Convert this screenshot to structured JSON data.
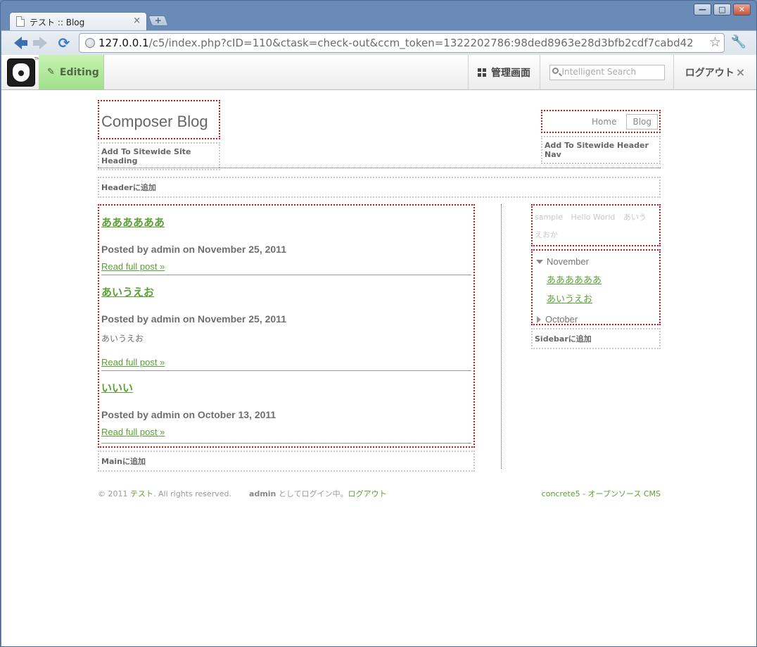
{
  "browser": {
    "tab_title": "テスト :: Blog",
    "tab_close": "×",
    "new_tab": "+",
    "url_host": "127.0.0.1",
    "url_rest": "/c5/index.php?cID=110&ctask=check-out&ccm_token=1322202786:98ded8963e28d3bfb2cdf7cabd42",
    "window_controls": {
      "minimize": "—",
      "maximize": "□",
      "close": "✕"
    }
  },
  "c5bar": {
    "editing_label": "Editing",
    "dashboard_label": "管理画面",
    "search_placeholder": "Intelligent Search",
    "logout_label": "ログアウト",
    "logout_close": "×",
    "tm": "TM"
  },
  "header": {
    "site_name": "Composer Blog",
    "site_heading_add": "Add To Sitewide Site Heading",
    "nav": [
      {
        "label": "Home"
      },
      {
        "label": "Blog"
      }
    ],
    "nav_add": "Add To Sitewide Header Nav",
    "header_add": "Headerに追加"
  },
  "posts": [
    {
      "title": "ああああああ",
      "meta": "Posted by admin on November 25, 2011",
      "excerpt": "",
      "read_more": "Read full post »"
    },
    {
      "title": "あいうえお",
      "meta": "Posted by admin on November 25, 2011",
      "excerpt": "あいうえお",
      "read_more": "Read full post »"
    },
    {
      "title": "いいい",
      "meta": "Posted by admin on October 13, 2011",
      "excerpt": "",
      "read_more": "Read full post »"
    }
  ],
  "main_add": "Mainに追加",
  "sidebar": {
    "tags": [
      "sample",
      "Hello World",
      "あいう",
      "えおか"
    ],
    "archive": [
      {
        "month": "November",
        "posts": [
          "ああああああ",
          "あいうえお"
        ]
      },
      {
        "month": "October",
        "posts": []
      }
    ],
    "sidebar_add": "Sidebarに追加"
  },
  "footer": {
    "copyright": "© 2011",
    "site_link": "テスト",
    "rights": ".   All rights reserved.",
    "user": "admin",
    "logged_in": "としてログイン中。",
    "logout_link": "ログアウト",
    "powered": "concrete5 - オープンソース CMS"
  }
}
